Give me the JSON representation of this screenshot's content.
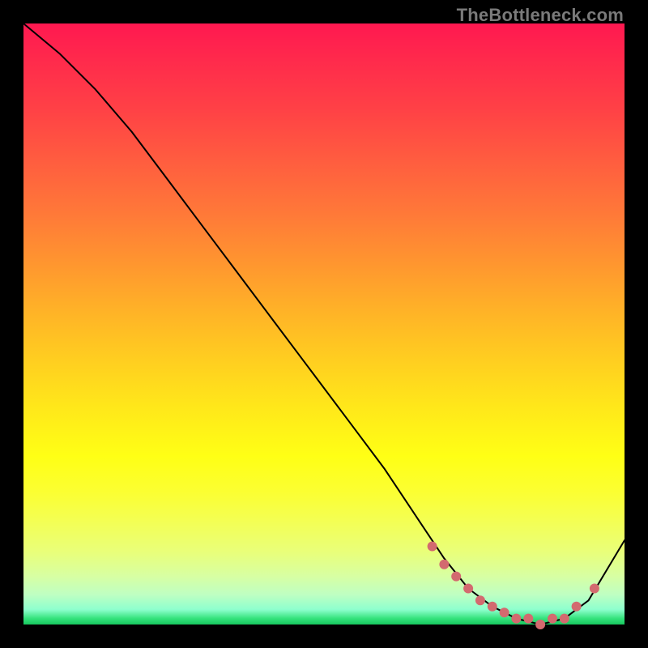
{
  "watermark": "TheBottleneck.com",
  "colors": {
    "dot": "#d36a6f",
    "curve": "#000000",
    "border": "#000000"
  },
  "chart_data": {
    "type": "line",
    "title": "",
    "xlabel": "",
    "ylabel": "",
    "xlim": [
      0,
      100
    ],
    "ylim": [
      0,
      100
    ],
    "grid": false,
    "legend": false,
    "series": [
      {
        "name": "bottleneck-curve",
        "x": [
          0,
          6,
          12,
          18,
          24,
          30,
          36,
          42,
          48,
          54,
          60,
          66,
          70,
          74,
          78,
          82,
          86,
          90,
          94,
          100
        ],
        "y": [
          100,
          95,
          89,
          82,
          74,
          66,
          58,
          50,
          42,
          34,
          26,
          17,
          11,
          6,
          3,
          1,
          0,
          1,
          4,
          14
        ]
      }
    ],
    "dots": {
      "name": "highlight-dots",
      "x": [
        68,
        70,
        72,
        74,
        76,
        78,
        80,
        82,
        84,
        86,
        88,
        90,
        92,
        95
      ],
      "y": [
        13,
        10,
        8,
        6,
        4,
        3,
        2,
        1,
        1,
        0,
        1,
        1,
        3,
        6
      ]
    }
  }
}
